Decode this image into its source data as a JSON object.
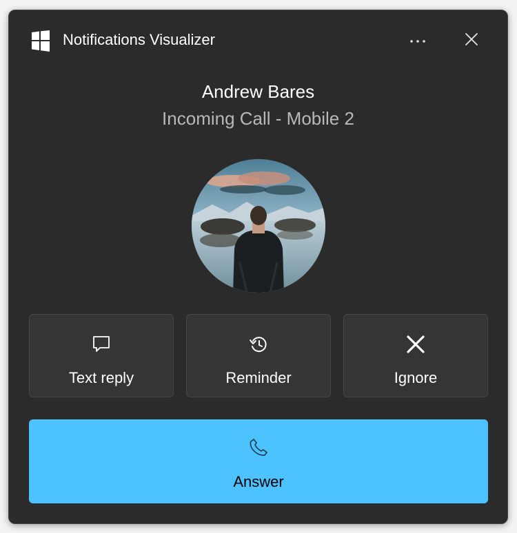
{
  "app": {
    "title": "Notifications Visualizer",
    "icon": "windows-logo-icon"
  },
  "header": {
    "more_icon": "more-horizontal-icon",
    "close_icon": "close-icon"
  },
  "call": {
    "caller_name": "Andrew Bares",
    "subtitle": "Incoming Call - Mobile 2"
  },
  "actions": [
    {
      "label": "Text reply",
      "icon": "message-bubble-icon"
    },
    {
      "label": "Reminder",
      "icon": "history-clock-icon"
    },
    {
      "label": "Ignore",
      "icon": "x-icon"
    }
  ],
  "answer": {
    "label": "Answer",
    "icon": "phone-icon"
  },
  "colors": {
    "toast_background": "#2b2b2b",
    "button_background": "#353535",
    "answer_accent": "#4cc2ff",
    "subtitle_text": "#b8b8b8"
  }
}
